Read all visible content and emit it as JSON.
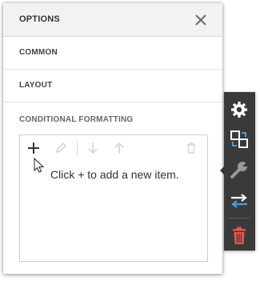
{
  "header": {
    "title": "OPTIONS",
    "close_icon": "close-icon"
  },
  "sections": {
    "common": "COMMON",
    "layout": "LAYOUT",
    "conditional_formatting": "CONDITIONAL FORMATTING"
  },
  "formatting_list": {
    "toolbar": [
      "plus-icon",
      "pencil-icon",
      "arrow-down-icon",
      "arrow-up-icon",
      "trash-icon"
    ],
    "empty_message": "Click + to add a new item."
  },
  "side_toolbar": {
    "items": [
      "gear-icon",
      "layers-icon",
      "wrench-icon",
      "swap-arrows-icon",
      "trash-icon"
    ],
    "accent_color": "#4a9bd8",
    "danger_color": "#e8554e"
  }
}
